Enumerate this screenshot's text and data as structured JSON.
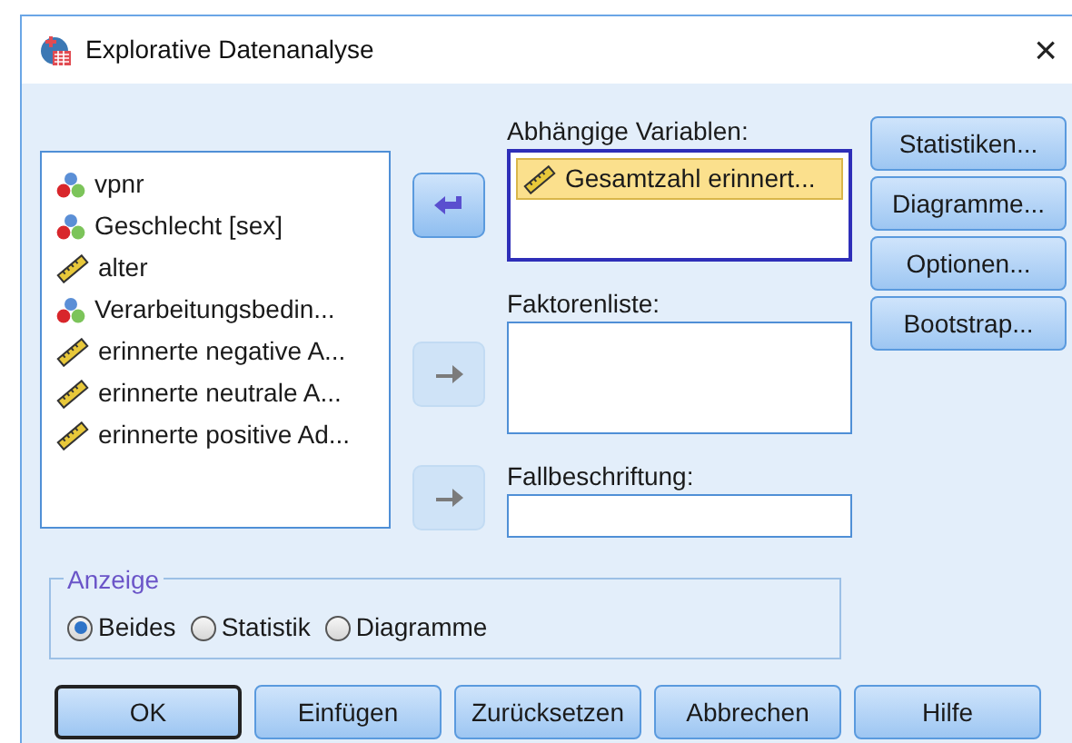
{
  "window": {
    "title": "Explorative Datenanalyse",
    "close": "×"
  },
  "source_list": {
    "items": [
      {
        "label": "vpnr",
        "kind": "nominal",
        "selected": false
      },
      {
        "label": "Geschlecht [sex]",
        "kind": "nominal",
        "selected": false
      },
      {
        "label": "alter",
        "kind": "scale",
        "selected": false
      },
      {
        "label": "Verarbeitungsbedin...",
        "kind": "nominal",
        "selected": false
      },
      {
        "label": "erinnerte negative A...",
        "kind": "scale",
        "selected": false
      },
      {
        "label": "erinnerte neutrale A...",
        "kind": "scale",
        "selected": false
      },
      {
        "label": "erinnerte positive Ad...",
        "kind": "scale",
        "selected": false
      }
    ]
  },
  "move_buttons": [
    {
      "disabled": false
    },
    {
      "disabled": true
    },
    {
      "disabled": true
    }
  ],
  "targets": [
    {
      "label": "Abhängige Variablen:",
      "focused": true,
      "items": [
        {
          "label": "Gesamtzahl erinnert...",
          "kind": "scale",
          "selected": true
        }
      ]
    },
    {
      "label": "Faktorenliste:",
      "focused": false
    },
    {
      "label": "Fallbeschriftung:",
      "focused": false
    }
  ],
  "side_buttons": [
    "Statistiken...",
    "Diagramme...",
    "Optionen...",
    "Bootstrap..."
  ],
  "display_group": {
    "title": "Anzeige",
    "options": [
      {
        "label": "Beides",
        "selected": true
      },
      {
        "label": "Statistik",
        "selected": false
      },
      {
        "label": "Diagramme",
        "selected": false
      }
    ]
  },
  "bottom_buttons": [
    {
      "label": "OK",
      "default": true
    },
    {
      "label": "Einfügen",
      "default": false
    },
    {
      "label": "Zurücksetzen",
      "default": false
    },
    {
      "label": "Abbrechen",
      "default": false
    },
    {
      "label": "Hilfe",
      "default": false
    }
  ]
}
